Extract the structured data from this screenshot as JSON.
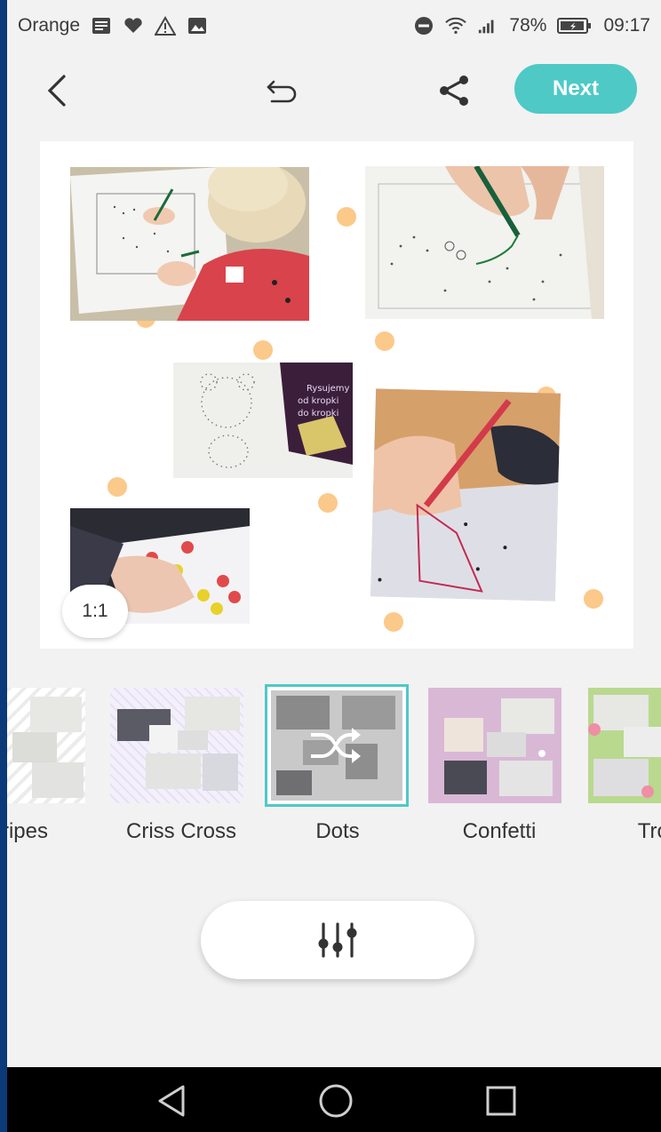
{
  "status_bar": {
    "carrier": "Orange",
    "battery": "78%",
    "time": "09:17"
  },
  "toolbar": {
    "next_label": "Next"
  },
  "canvas": {
    "ratio_label": "1:1",
    "photo_book_text_1": "Rysujemy",
    "photo_book_text_2": "od kropki",
    "photo_book_text_3": "do kropki"
  },
  "layouts": [
    {
      "label": "ripes"
    },
    {
      "label": "Criss Cross"
    },
    {
      "label": "Dots",
      "selected": true
    },
    {
      "label": "Confetti"
    },
    {
      "label": "Trop"
    }
  ],
  "colors": {
    "accent": "#4ec9c6",
    "dot": "#fbc98a",
    "nav_bar": "#000000"
  }
}
